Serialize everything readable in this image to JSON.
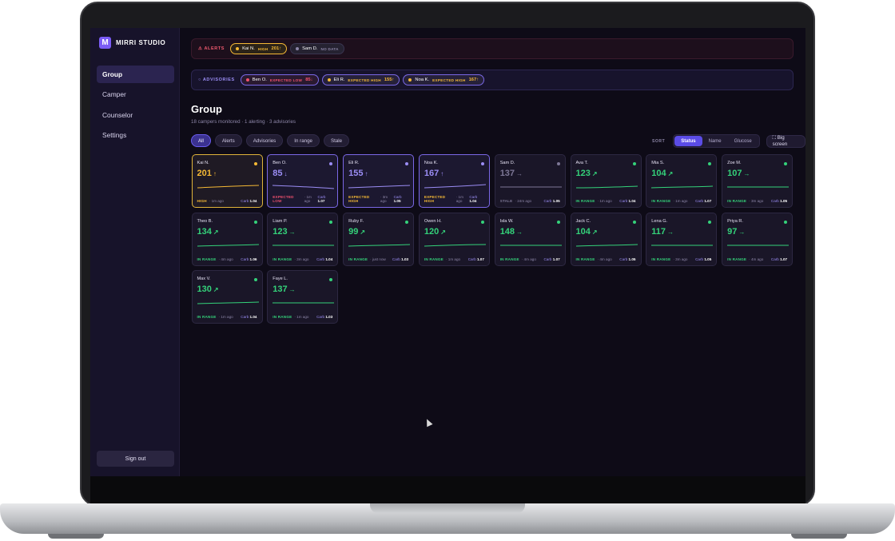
{
  "app": {
    "name": "MIRRI STUDIO",
    "logo_letter": "M",
    "accent": "#7b5cf5"
  },
  "sidebar": {
    "items": [
      {
        "label": "Group",
        "active": true
      },
      {
        "label": "Camper",
        "active": false
      },
      {
        "label": "Counselor",
        "active": false
      },
      {
        "label": "Settings",
        "active": false
      }
    ],
    "signout_label": "Sign out"
  },
  "alerts": {
    "label": "⚠ ALERTS",
    "pills": [
      {
        "name": "Kai N.",
        "status": "HIGH",
        "value": "201↑",
        "color": "#f5b935"
      },
      {
        "name": "Sam D.",
        "status": "NO DATA",
        "value": "",
        "color": "#8d86a8"
      }
    ]
  },
  "advisories": {
    "label": "○ ADVISORIES",
    "pills": [
      {
        "name": "Ben O.",
        "status": "EXPECTED LOW",
        "value": "85↓",
        "color": "#f0506e"
      },
      {
        "name": "Eli R.",
        "status": "EXPECTED HIGH",
        "value": "155↑",
        "color": "#f5b935"
      },
      {
        "name": "Noa K.",
        "status": "EXPECTED HIGH",
        "value": "167↑",
        "color": "#f5b935"
      }
    ]
  },
  "page": {
    "title": "Group",
    "subtitle": "18 campers monitored · 1 alerting · 3 advisories"
  },
  "filters": [
    "All",
    "Alerts",
    "Advisories",
    "In range",
    "Stale"
  ],
  "sort": {
    "label": "SORT",
    "options": [
      "Status",
      "Name",
      "Glucose"
    ],
    "active": "Status",
    "bigscreen_label": "⛶ Big screen"
  },
  "colors": {
    "high": "#f5b935",
    "low": "#f0506e",
    "expected": "#9b8df5",
    "in_range": "#34d27a",
    "stale": "#7d7796"
  },
  "campers": [
    {
      "name": "Kai N.",
      "value": "201",
      "trend": "↑",
      "status": "HIGH",
      "ago": "· 1m ago",
      "carb": "1.04",
      "kind": "high"
    },
    {
      "name": "Ben O.",
      "value": "85",
      "trend": "↓",
      "status": "EXPECTED LOW",
      "ago": "· 1m ago",
      "carb": "1.07",
      "kind": "explow"
    },
    {
      "name": "Eli R.",
      "value": "155",
      "trend": "↑",
      "status": "EXPECTED HIGH",
      "ago": "· 3m ago",
      "carb": "1.05",
      "kind": "exphigh"
    },
    {
      "name": "Noa K.",
      "value": "167",
      "trend": "↑",
      "status": "EXPECTED HIGH",
      "ago": "· 1m ago",
      "carb": "1.04",
      "kind": "exphigh"
    },
    {
      "name": "Sam D.",
      "value": "137",
      "trend": "→",
      "status": "STALE",
      "ago": "· 24m ago",
      "carb": "1.05",
      "kind": "stale"
    },
    {
      "name": "Ava T.",
      "value": "123",
      "trend": "↗",
      "status": "IN RANGE",
      "ago": "· 1m ago",
      "carb": "1.04",
      "kind": "range"
    },
    {
      "name": "Mia S.",
      "value": "104",
      "trend": "↗",
      "status": "IN RANGE",
      "ago": "· 1m ago",
      "carb": "1.07",
      "kind": "range"
    },
    {
      "name": "Zoe M.",
      "value": "107",
      "trend": "→",
      "status": "IN RANGE",
      "ago": "· 3m ago",
      "carb": "1.05",
      "kind": "range"
    },
    {
      "name": "Theo B.",
      "value": "134",
      "trend": "↗",
      "status": "IN RANGE",
      "ago": "· 4m ago",
      "carb": "1.06",
      "kind": "range"
    },
    {
      "name": "Liam P.",
      "value": "123",
      "trend": "→",
      "status": "IN RANGE",
      "ago": "· 3m ago",
      "carb": "1.04",
      "kind": "range"
    },
    {
      "name": "Ruby F.",
      "value": "99",
      "trend": "↗",
      "status": "IN RANGE",
      "ago": "· just now",
      "carb": "1.03",
      "kind": "range"
    },
    {
      "name": "Owen H.",
      "value": "120",
      "trend": "↗",
      "status": "IN RANGE",
      "ago": "· 1m ago",
      "carb": "1.07",
      "kind": "range"
    },
    {
      "name": "Isla W.",
      "value": "148",
      "trend": "→",
      "status": "IN RANGE",
      "ago": "· 4m ago",
      "carb": "1.07",
      "kind": "range"
    },
    {
      "name": "Jack C.",
      "value": "104",
      "trend": "↗",
      "status": "IN RANGE",
      "ago": "· 4m ago",
      "carb": "1.05",
      "kind": "range"
    },
    {
      "name": "Lena G.",
      "value": "117",
      "trend": "→",
      "status": "IN RANGE",
      "ago": "· 3m ago",
      "carb": "1.05",
      "kind": "range"
    },
    {
      "name": "Priya R.",
      "value": "97",
      "trend": "→",
      "status": "IN RANGE",
      "ago": "· 4m ago",
      "carb": "1.07",
      "kind": "range"
    },
    {
      "name": "Max V.",
      "value": "130",
      "trend": "↗",
      "status": "IN RANGE",
      "ago": "· 1m ago",
      "carb": "1.04",
      "kind": "range"
    },
    {
      "name": "Faye L.",
      "value": "137",
      "trend": "→",
      "status": "IN RANGE",
      "ago": "· 1m ago",
      "carb": "1.03",
      "kind": "range"
    }
  ],
  "carb_label": "Carb"
}
